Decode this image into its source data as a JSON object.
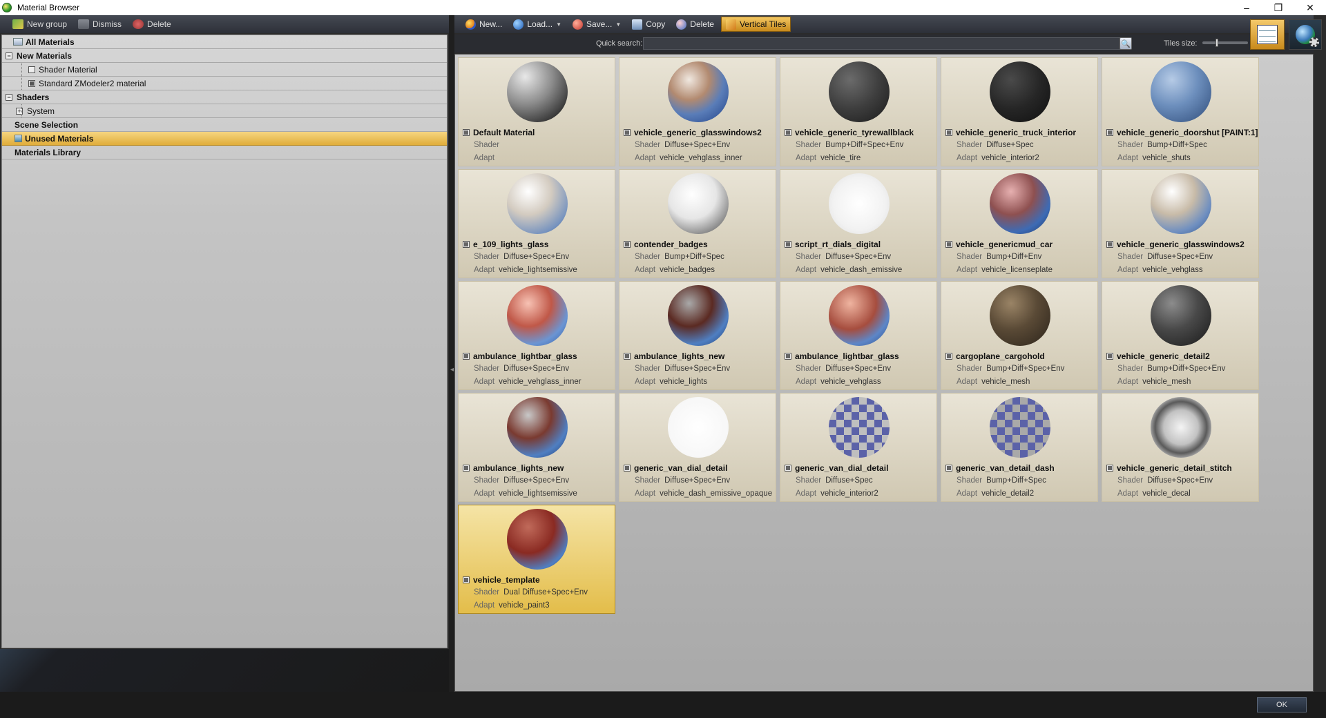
{
  "window": {
    "title": "Material Browser",
    "minimize": "–",
    "maximize": "❐",
    "close": "✕"
  },
  "left_toolbar": {
    "new_group": "New group",
    "dismiss": "Dismiss",
    "delete": "Delete"
  },
  "tree": {
    "all_materials": "All Materials",
    "new_materials": "New Materials",
    "shader_material": "Shader Material",
    "standard_material": "Standard ZModeler2 material",
    "shaders": "Shaders",
    "system": "System",
    "scene_selection": "Scene Selection",
    "unused_materials": "Unused Materials",
    "materials_library": "Materials Library"
  },
  "right_toolbar": {
    "new": "New...",
    "load": "Load...",
    "save": "Save...",
    "copy": "Copy",
    "delete": "Delete",
    "vertical_tiles": "Vertical Tiles"
  },
  "search": {
    "label": "Quick search:",
    "value": "",
    "button": "🔍"
  },
  "tiles_size": {
    "label": "Tiles size:",
    "level": 0.3
  },
  "ok_label": "OK",
  "materials": [
    {
      "name": "Default Material",
      "shader_label": "Shader",
      "shader": "",
      "adapt_label": "Adapt",
      "adapt": ""
    },
    {
      "name": "vehicle_generic_glasswindows2",
      "shader_label": "Shader",
      "shader": "Diffuse+Spec+Env",
      "adapt_label": "Adapt",
      "adapt": "vehicle_vehglass_inner"
    },
    {
      "name": "vehicle_generic_tyrewallblack",
      "shader_label": "Shader",
      "shader": "Bump+Diff+Spec+Env",
      "adapt_label": "Adapt",
      "adapt": "vehicle_tire"
    },
    {
      "name": "vehicle_generic_truck_interior",
      "shader_label": "Shader",
      "shader": "Diffuse+Spec",
      "adapt_label": "Adapt",
      "adapt": "vehicle_interior2"
    },
    {
      "name": "vehicle_generic_doorshut [PAINT:1]",
      "shader_label": "Shader",
      "shader": "Bump+Diff+Spec",
      "adapt_label": "Adapt",
      "adapt": "vehicle_shuts"
    },
    {
      "name": "e_109_lights_glass",
      "shader_label": "Shader",
      "shader": "Diffuse+Spec+Env",
      "adapt_label": "Adapt",
      "adapt": "vehicle_lightsemissive"
    },
    {
      "name": "contender_badges",
      "shader_label": "Shader",
      "shader": "Bump+Diff+Spec",
      "adapt_label": "Adapt",
      "adapt": "vehicle_badges"
    },
    {
      "name": "script_rt_dials_digital",
      "shader_label": "Shader",
      "shader": "Diffuse+Spec+Env",
      "adapt_label": "Adapt",
      "adapt": "vehicle_dash_emissive"
    },
    {
      "name": "vehicle_genericmud_car",
      "shader_label": "Shader",
      "shader": "Bump+Diff+Env",
      "adapt_label": "Adapt",
      "adapt": "vehicle_licenseplate"
    },
    {
      "name": "vehicle_generic_glasswindows2",
      "shader_label": "Shader",
      "shader": "Diffuse+Spec+Env",
      "adapt_label": "Adapt",
      "adapt": "vehicle_vehglass"
    },
    {
      "name": "ambulance_lightbar_glass",
      "shader_label": "Shader",
      "shader": "Diffuse+Spec+Env",
      "adapt_label": "Adapt",
      "adapt": "vehicle_vehglass_inner"
    },
    {
      "name": "ambulance_lights_new",
      "shader_label": "Shader",
      "shader": "Diffuse+Spec+Env",
      "adapt_label": "Adapt",
      "adapt": "vehicle_lights"
    },
    {
      "name": "ambulance_lightbar_glass",
      "shader_label": "Shader",
      "shader": "Diffuse+Spec+Env",
      "adapt_label": "Adapt",
      "adapt": "vehicle_vehglass"
    },
    {
      "name": "cargoplane_cargohold",
      "shader_label": "Shader",
      "shader": "Bump+Diff+Spec+Env",
      "adapt_label": "Adapt",
      "adapt": "vehicle_mesh"
    },
    {
      "name": "vehicle_generic_detail2",
      "shader_label": "Shader",
      "shader": "Bump+Diff+Spec+Env",
      "adapt_label": "Adapt",
      "adapt": "vehicle_mesh"
    },
    {
      "name": "ambulance_lights_new",
      "shader_label": "Shader",
      "shader": "Diffuse+Spec+Env",
      "adapt_label": "Adapt",
      "adapt": "vehicle_lightsemissive"
    },
    {
      "name": "generic_van_dial_detail",
      "shader_label": "Shader",
      "shader": "Diffuse+Spec+Env",
      "adapt_label": "Adapt",
      "adapt": "vehicle_dash_emissive_opaque"
    },
    {
      "name": "generic_van_dial_detail",
      "shader_label": "Shader",
      "shader": "Diffuse+Spec",
      "adapt_label": "Adapt",
      "adapt": "vehicle_interior2"
    },
    {
      "name": "generic_van_detail_dash",
      "shader_label": "Shader",
      "shader": "Bump+Diff+Spec",
      "adapt_label": "Adapt",
      "adapt": "vehicle_detail2"
    },
    {
      "name": "vehicle_generic_detail_stitch",
      "shader_label": "Shader",
      "shader": "Diffuse+Spec+Env",
      "adapt_label": "Adapt",
      "adapt": "vehicle_decal"
    },
    {
      "name": "vehicle_template",
      "shader_label": "Shader",
      "shader": "Dual Diffuse+Spec+Env",
      "adapt_label": "Adapt",
      "adapt": "vehicle_paint3"
    }
  ]
}
